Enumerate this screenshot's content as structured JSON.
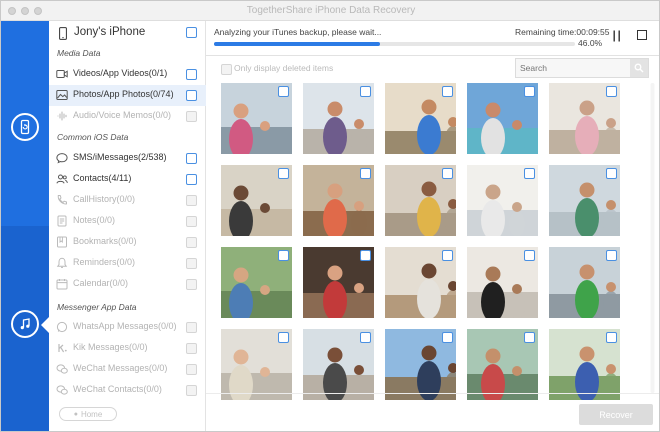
{
  "window": {
    "title": "TogetherShare iPhone Data Recovery"
  },
  "device": {
    "name": "Jony's iPhone",
    "icon": "iphone-icon"
  },
  "sections": {
    "media": "Media Data",
    "ios": "Common iOS Data",
    "messenger": "Messenger App Data"
  },
  "items": [
    {
      "label": "Videos/App Videos(0/1)",
      "icon": "video-icon",
      "enabled": true,
      "checked": false
    },
    {
      "label": "Photos/App Photos(0/74)",
      "icon": "photo-icon",
      "enabled": true,
      "checked": false,
      "selected": true
    },
    {
      "label": "Audio/Voice Memos(0/0)",
      "icon": "audio-icon",
      "enabled": false
    },
    {
      "label": "SMS/iMessages(2/538)",
      "icon": "message-icon",
      "enabled": true
    },
    {
      "label": "Contacts(4/11)",
      "icon": "contacts-icon",
      "enabled": true
    },
    {
      "label": "CallHistory(0/0)",
      "icon": "phone-icon",
      "enabled": false
    },
    {
      "label": "Notes(0/0)",
      "icon": "notes-icon",
      "enabled": false
    },
    {
      "label": "Bookmarks(0/0)",
      "icon": "bookmark-icon",
      "enabled": false
    },
    {
      "label": "Reminders(0/0)",
      "icon": "reminder-icon",
      "enabled": false
    },
    {
      "label": "Calendar(0/0)",
      "icon": "calendar-icon",
      "enabled": false
    },
    {
      "label": "WhatsApp Messages(0/0)",
      "icon": "whatsapp-icon",
      "enabled": false
    },
    {
      "label": "Kik Messages(0/0)",
      "icon": "kik-icon",
      "enabled": false
    },
    {
      "label": "WeChat Messages(0/0)",
      "icon": "wechat-icon",
      "enabled": false
    },
    {
      "label": "WeChat Contacts(0/0)",
      "icon": "wechat-contacts-icon",
      "enabled": false
    }
  ],
  "home_button": "Home",
  "status": {
    "message": "Analyzing your iTunes backup, please wait...",
    "remaining": "Remaining time:00:09:55",
    "percent": "46.0%",
    "progress": 0.46
  },
  "filter": {
    "label": "Only display deleted items"
  },
  "search": {
    "placeholder": "Search"
  },
  "recover_button": "Recover",
  "colors": {
    "accent": "#1f6fe0",
    "progress": "#2c7be5",
    "checkbox_border": "#4a90e2"
  },
  "photos": [
    {
      "sky": "#c7d3dc",
      "ground": "#8a9aa6",
      "skin": "#d9a07f",
      "shirt": "#d15a82"
    },
    {
      "sky": "#dde4ea",
      "ground": "#b9b3aa",
      "skin": "#c98c6a",
      "shirt": "#6e5c8c"
    },
    {
      "sky": "#e7dcc9",
      "ground": "#9a8a6e",
      "skin": "#c48a62",
      "shirt": "#3b7bd1"
    },
    {
      "sky": "#6fa6d8",
      "ground": "#5fb5c8",
      "skin": "#c98a6a",
      "shirt": "#e2e2e2"
    },
    {
      "sky": "#eae6df",
      "ground": "#bfb1a0",
      "skin": "#caa188",
      "shirt": "#e6aeb9"
    },
    {
      "sky": "#d9d3c6",
      "ground": "#c6b9a4",
      "skin": "#6b4a36",
      "shirt": "#3a3a3a"
    },
    {
      "sky": "#c4b39a",
      "ground": "#8b6c4e",
      "skin": "#d7a07f",
      "shirt": "#e06a4a"
    },
    {
      "sky": "#d8cfc2",
      "ground": "#a99b88",
      "skin": "#8a5c41",
      "shirt": "#e0b44a"
    },
    {
      "sky": "#f1f0ec",
      "ground": "#cfd4d8",
      "skin": "#caa58a",
      "shirt": "#e9e9e9"
    },
    {
      "sky": "#cfd8de",
      "ground": "#b6c1c7",
      "skin": "#c5906c",
      "shirt": "#4a8f6c"
    },
    {
      "sky": "#8fb07a",
      "ground": "#6a8a5a",
      "skin": "#d6a682",
      "shirt": "#4d7db5"
    },
    {
      "sky": "#4a3a30",
      "ground": "#8a6a52",
      "skin": "#d9a282",
      "shirt": "#c23a3a"
    },
    {
      "sky": "#e4ddd2",
      "ground": "#b49a7c",
      "skin": "#6a4632",
      "shirt": "#e5e2dc"
    },
    {
      "sky": "#ece8e2",
      "ground": "#c7c1b8",
      "skin": "#a97a58",
      "shirt": "#202020"
    },
    {
      "sky": "#c8d2d8",
      "ground": "#8f9aa2",
      "skin": "#c7916e",
      "shirt": "#3fa34a"
    },
    {
      "sky": "#e2dfd8",
      "ground": "#bfb9ae",
      "skin": "#e0b596",
      "shirt": "#e0d9c8"
    },
    {
      "sky": "#d7dfe4",
      "ground": "#b8b0a5",
      "skin": "#7a4f38",
      "shirt": "#4a4a4a"
    },
    {
      "sky": "#8fb9e0",
      "ground": "#8a7a62",
      "skin": "#6a4632",
      "shirt": "#2e3e5c"
    },
    {
      "sky": "#a8c7b4",
      "ground": "#6a8a6e",
      "skin": "#c4906b",
      "shirt": "#c84a4a"
    },
    {
      "sky": "#d6e2d0",
      "ground": "#7fa26a",
      "skin": "#c9926e",
      "shirt": "#3c5fb0"
    }
  ]
}
